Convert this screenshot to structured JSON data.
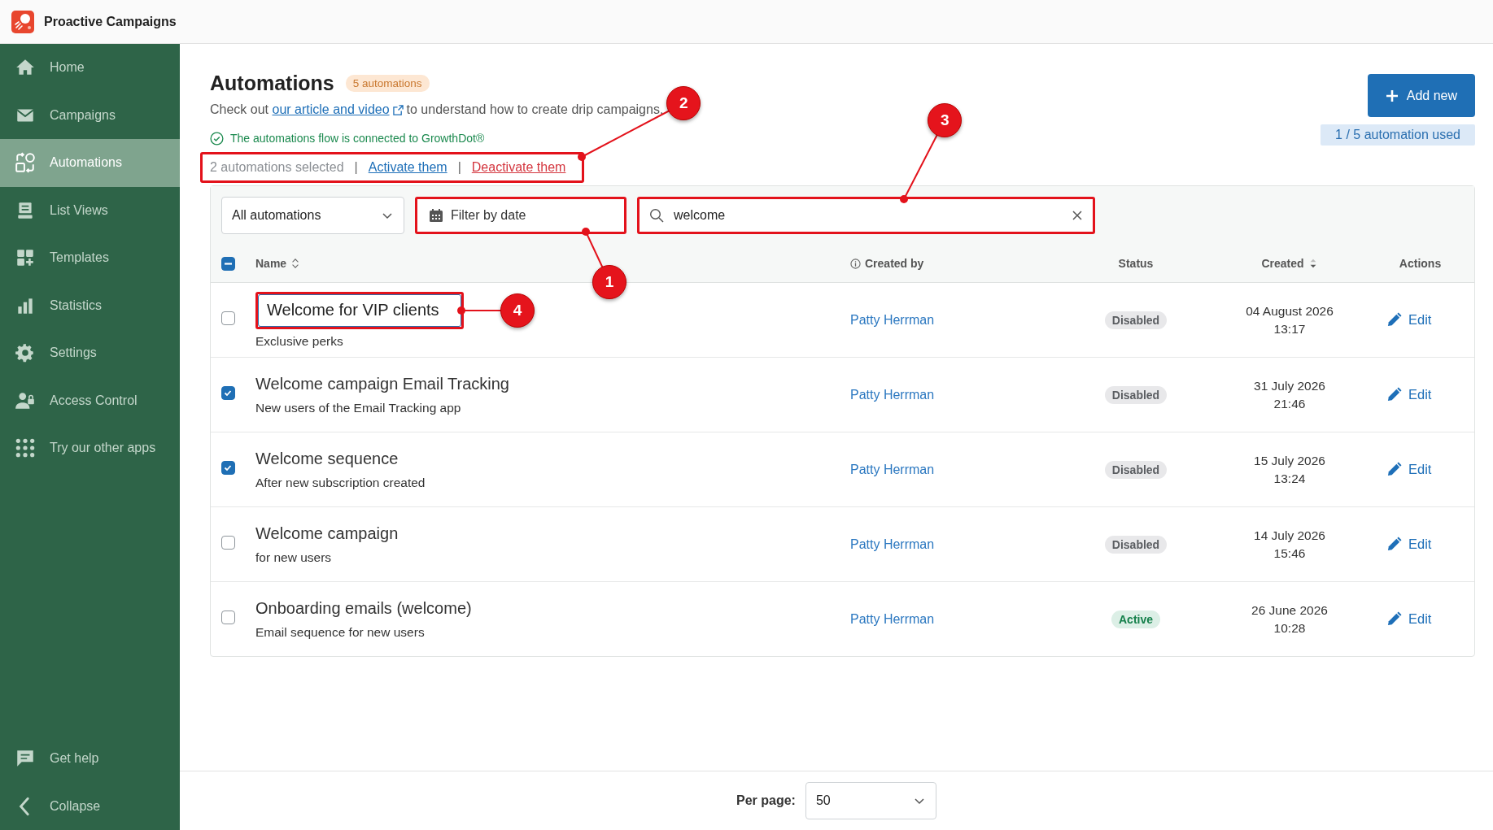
{
  "app": {
    "title": "Proactive Campaigns"
  },
  "sidebar": {
    "items": [
      {
        "label": "Home",
        "selected": false
      },
      {
        "label": "Campaigns",
        "selected": false
      },
      {
        "label": "Automations",
        "selected": true
      },
      {
        "label": "List Views",
        "selected": false
      },
      {
        "label": "Templates",
        "selected": false
      },
      {
        "label": "Statistics",
        "selected": false
      },
      {
        "label": "Settings",
        "selected": false
      },
      {
        "label": "Access Control",
        "selected": false
      },
      {
        "label": "Try our other apps",
        "selected": false
      }
    ],
    "footer_items": [
      {
        "label": "Get help"
      },
      {
        "label": "Collapse"
      }
    ]
  },
  "page": {
    "title": "Automations",
    "count_badge": "5 automations",
    "intro": {
      "before": "Check out",
      "link": "our article and video",
      "after": "to understand how to create drip campaigns."
    },
    "connection": {
      "text": "The automations flow is connected to GrowthDot®",
      "connected": true
    },
    "bulk_actions": {
      "annotation": "2",
      "items": [
        {
          "kind": "count",
          "text": "2 automations selected"
        },
        {
          "kind": "separator",
          "text": "|"
        },
        {
          "kind": "link",
          "text": "Activate them"
        },
        {
          "kind": "separator",
          "text": "|"
        },
        {
          "kind": "danger",
          "text": "Deactivate them"
        }
      ]
    },
    "add_button": "Add new",
    "usage": "1 / 5 automation used"
  },
  "toolbar": {
    "scope_select": {
      "value": "All automations"
    },
    "date_filter": {
      "label": "Filter by date",
      "annotation": "1"
    },
    "search": {
      "value": "welcome",
      "annotation": "3"
    }
  },
  "table": {
    "select_all": {
      "partial": true
    },
    "columns": [
      {
        "label": "Name",
        "sortable": true,
        "sorted": false
      },
      {
        "label": "Created by",
        "info": true,
        "sortable": false
      },
      {
        "label": "Status",
        "sortable": false
      },
      {
        "label": "Created",
        "sortable": true,
        "sorted": true
      },
      {
        "label": "Actions",
        "sortable": false
      }
    ],
    "rows": [
      {
        "selected": false,
        "name": "Welcome for VIP clients",
        "editing": true,
        "annotation": "4",
        "description": "Exclusive perks",
        "created_by": "Patty Herrman",
        "status": "Disabled",
        "active": false,
        "date": "04 August 2026",
        "time": "13:17",
        "action": "Edit"
      },
      {
        "selected": true,
        "name": "Welcome campaign Email Tracking",
        "editing": false,
        "description": "New users of the Email Tracking app",
        "created_by": "Patty Herrman",
        "status": "Disabled",
        "active": false,
        "date": "31 July 2026",
        "time": "21:46",
        "action": "Edit"
      },
      {
        "selected": true,
        "name": "Welcome sequence",
        "editing": false,
        "description": "After new subscription created",
        "created_by": "Patty Herrman",
        "status": "Disabled",
        "active": false,
        "date": "15 July 2026",
        "time": "13:24",
        "action": "Edit"
      },
      {
        "selected": false,
        "name": "Welcome campaign",
        "editing": false,
        "description": "for new users",
        "created_by": "Patty Herrman",
        "status": "Disabled",
        "active": false,
        "date": "14 July 2026",
        "time": "15:46",
        "action": "Edit"
      },
      {
        "selected": false,
        "name": "Onboarding emails (welcome)",
        "editing": false,
        "description": "Email sequence for new users",
        "created_by": "Patty Herrman",
        "status": "Active",
        "active": true,
        "date": "26 June 2026",
        "time": "10:28",
        "action": "Edit"
      }
    ]
  },
  "pagination": {
    "label": "Per page:",
    "value": "50"
  }
}
